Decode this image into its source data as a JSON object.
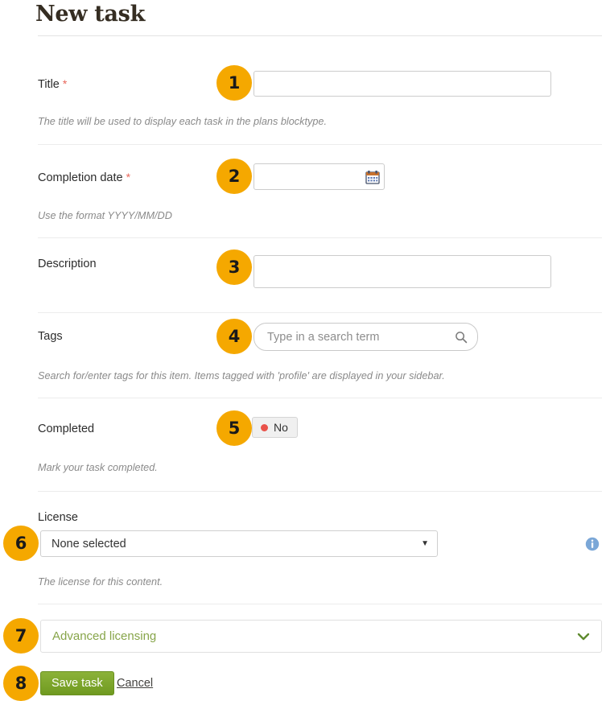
{
  "page": {
    "title": "New task"
  },
  "fields": {
    "title": {
      "label": "Title",
      "required_mark": "*",
      "value": "",
      "help": "The title will be used to display each task in the plans blocktype."
    },
    "completion_date": {
      "label": "Completion date",
      "required_mark": "*",
      "value": "",
      "help": "Use the format YYYY/MM/DD",
      "calendar_icon": "calendar-icon"
    },
    "description": {
      "label": "Description",
      "value": ""
    },
    "tags": {
      "label": "Tags",
      "value": "",
      "placeholder": "Type in a search term",
      "search_icon": "search-icon",
      "help": "Search for/enter tags for this item. Items tagged with 'profile' are displayed in your sidebar."
    },
    "completed": {
      "label": "Completed",
      "toggle_value": "No",
      "status_color": "#e9524a",
      "help": "Mark your task completed."
    },
    "license": {
      "label": "License",
      "selected": "None selected",
      "caret": "▼",
      "info_icon": "info-icon",
      "help": "The license for this content."
    },
    "advanced_licensing": {
      "title": "Advanced licensing",
      "chevron": "chevron-down-icon"
    }
  },
  "footer": {
    "save_label": "Save task",
    "cancel_label": "Cancel"
  },
  "badges": {
    "b1": "1",
    "b2": "2",
    "b3": "3",
    "b4": "4",
    "b5": "5",
    "b6": "6",
    "b7": "7",
    "b8": "8"
  },
  "colors": {
    "badge": "#f5a800",
    "save_button": "#7ba428",
    "required": "#e8665a",
    "accent_green": "#87a54a"
  }
}
